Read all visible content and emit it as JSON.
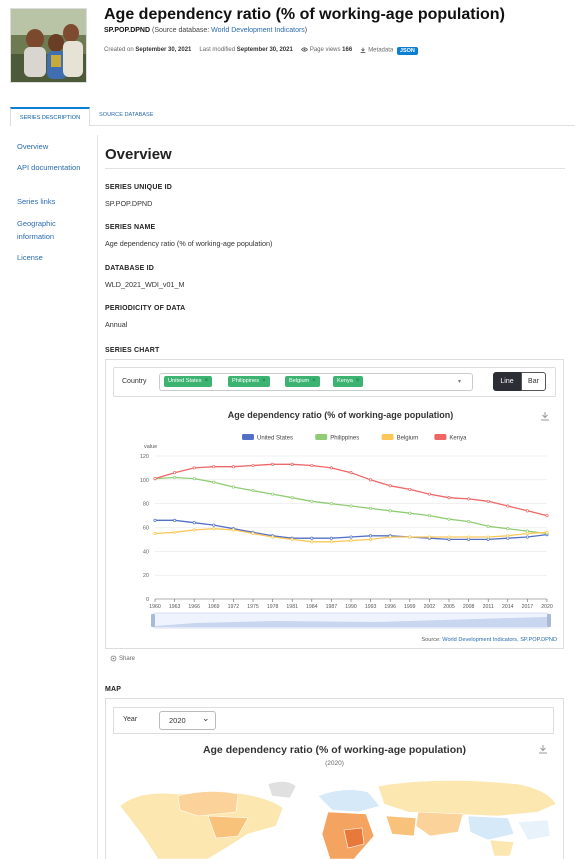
{
  "header": {
    "title": "Age dependency ratio (% of working-age population)",
    "code": "SP.POP.DPND",
    "source_prefix": "(Source database: ",
    "source_name": "World Development Indicators",
    "source_suffix": ")",
    "created_label": "Created on",
    "created_date": "September 30, 2021",
    "modified_label": "Last modified",
    "modified_date": "September 30, 2021",
    "views_label": "Page views",
    "views_count": "166",
    "metadata_label": "Metadata",
    "json_badge": "JSON"
  },
  "tabs": {
    "active": "SERIES DESCRIPTION",
    "inactive": "SOURCE DATABASE"
  },
  "sidebar": {
    "items": [
      "Overview",
      "API documentation",
      "Series links",
      "Geographic information",
      "License"
    ]
  },
  "overview": {
    "heading": "Overview",
    "fields": [
      {
        "label": "SERIES UNIQUE ID",
        "value": "SP.POP.DPND"
      },
      {
        "label": "SERIES NAME",
        "value": "Age dependency ratio (% of working-age population)"
      },
      {
        "label": "DATABASE ID",
        "value": "WLD_2021_WDI_v01_M"
      },
      {
        "label": "PERIODICITY OF DATA",
        "value": "Annual"
      }
    ],
    "series_chart_label": "SERIES CHART",
    "map_label": "MAP"
  },
  "chart_filter": {
    "country_label": "Country",
    "chips": [
      "United States",
      "Philippines",
      "Belgium",
      "Kenya"
    ],
    "chip_close": "×",
    "btn_line": "Line",
    "btn_bar": "Bar",
    "share": "Share"
  },
  "colors": {
    "united_states": "#5470c6",
    "philippines": "#91cc75",
    "belgium": "#fac858",
    "kenya": "#ee6666"
  },
  "chart_data": {
    "type": "line",
    "title": "Age dependency ratio (% of working-age population)",
    "ylabel": "value",
    "xlabel": "",
    "ylim": [
      0,
      120
    ],
    "yticks": [
      0,
      20,
      40,
      60,
      80,
      100,
      120
    ],
    "xticks": [
      1960,
      1963,
      1966,
      1969,
      1972,
      1975,
      1978,
      1981,
      1984,
      1987,
      1990,
      1993,
      1996,
      1999,
      2002,
      2005,
      2008,
      2011,
      2014,
      2017,
      2020
    ],
    "legend_position": "top",
    "grid": "horizontal",
    "source_prefix": "Source: ",
    "source_link": "World Development Indicators, SP.POP.DPND",
    "x": [
      1960,
      1963,
      1966,
      1969,
      1972,
      1975,
      1978,
      1981,
      1984,
      1987,
      1990,
      1993,
      1996,
      1999,
      2002,
      2005,
      2008,
      2011,
      2014,
      2017,
      2020
    ],
    "series": [
      {
        "name": "United States",
        "values": [
          66,
          66,
          64,
          62,
          59,
          56,
          53,
          51,
          51,
          51,
          52,
          53,
          53,
          52,
          51,
          50,
          50,
          50,
          51,
          52,
          54
        ]
      },
      {
        "name": "Philippines",
        "values": [
          101,
          102,
          101,
          98,
          94,
          91,
          88,
          85,
          82,
          80,
          78,
          76,
          74,
          72,
          70,
          67,
          65,
          61,
          59,
          57,
          55
        ]
      },
      {
        "name": "Belgium",
        "values": [
          55,
          56,
          58,
          59,
          58,
          55,
          52,
          50,
          48,
          48,
          49,
          50,
          52,
          52,
          52,
          52,
          52,
          52,
          53,
          55,
          56
        ]
      },
      {
        "name": "Kenya",
        "values": [
          101,
          106,
          110,
          111,
          111,
          112,
          113,
          113,
          112,
          110,
          106,
          100,
          95,
          92,
          88,
          85,
          84,
          82,
          78,
          74,
          70
        ]
      }
    ]
  },
  "map": {
    "year_label": "Year",
    "year_value": "2020",
    "title": "Age dependency ratio (% of working-age population)",
    "subtitle": "(2020)"
  }
}
